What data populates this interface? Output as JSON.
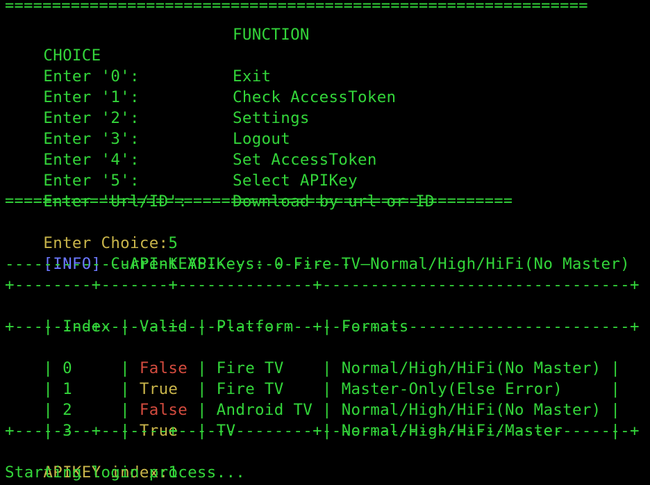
{
  "terminal": {
    "top_cut_text": "                                              y g",
    "separator_long": "==============================================================",
    "menu": {
      "header_choice": "CHOICE",
      "header_function": "FUNCTION",
      "items": [
        {
          "choice": "Enter '0':",
          "function": "Exit"
        },
        {
          "choice": "Enter '1':",
          "function": "Check AccessToken"
        },
        {
          "choice": "Enter '2':",
          "function": "Settings"
        },
        {
          "choice": "Enter '3':",
          "function": "Logout"
        },
        {
          "choice": "Enter '4':",
          "function": "Set AccessToken"
        },
        {
          "choice": "Enter '5':",
          "function": "Select APIKey"
        },
        {
          "choice": "Enter 'Url/ID':",
          "function": "Download by url or ID"
        }
      ]
    },
    "prompt_choice": {
      "label": "Enter Choice:",
      "value": "5"
    },
    "info": {
      "tag": "[INFO]",
      "text": " Current APIKeys: 0 Fire TV—Normal/High/HiFi(No Master)"
    },
    "apikeys_title": "-------------API-KEYS---------------",
    "table_border": "+--------+-------+--------------+--------------------------------+",
    "table_header": {
      "c1": "| Index | Valid | Platform   | Formats                      |",
      "index": "Index",
      "valid": "Valid",
      "platform": "Platform",
      "formats": "Formats"
    },
    "rows": [
      {
        "index": "0",
        "valid": "False",
        "platform": "Fire TV",
        "formats": "Normal/High/HiFi(No Master)"
      },
      {
        "index": "1",
        "valid": "True",
        "platform": "Fire TV",
        "formats": "Master-Only(Else Error)"
      },
      {
        "index": "2",
        "valid": "False",
        "platform": "Android TV",
        "formats": "Normal/High/HiFi(No Master)"
      },
      {
        "index": "3",
        "valid": "True",
        "platform": "TV",
        "formats": "Normal/High/HiFi/Master"
      }
    ],
    "prompt_index": {
      "label": "APIKEY index:",
      "value": "1"
    },
    "status": "Starting login process..."
  },
  "colors": {
    "green": "#33d53a",
    "yellow": "#c8b44a",
    "red": "#d24b3e",
    "blue": "#6b78ff",
    "background": "#000000"
  }
}
